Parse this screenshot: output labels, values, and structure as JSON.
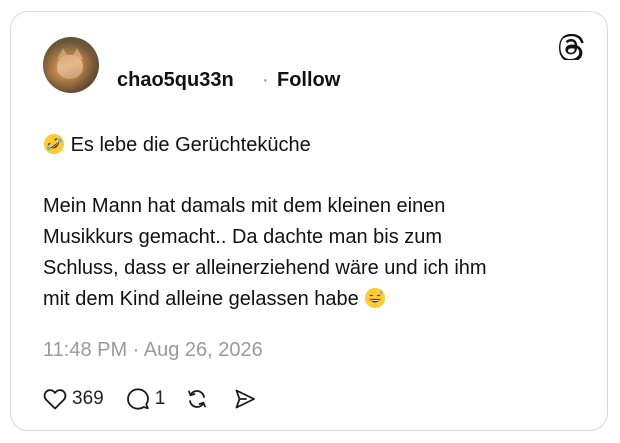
{
  "post": {
    "author": {
      "username": "chao5qu33n",
      "separator": "·",
      "follow_label": "Follow"
    },
    "text": {
      "line1": "Es lebe die Gerüchteküche",
      "line2": "Mein Mann hat damals mit dem kleinen einen",
      "line3": "Musikkurs gemacht.. Da dachte man bis zum",
      "line4": "Schluss, dass er alleinerziehend wäre und ich ihm",
      "line5": "mit dem Kind alleine gelassen habe"
    },
    "emojis": {
      "leading": "rolling-on-floor-laughing-emoji",
      "trailing": "grinning-face-with-sweat-emoji"
    },
    "timestamp": "11:48 PM · Aug 26, 2026",
    "actions": {
      "like_count": "369",
      "reply_count": "1"
    },
    "icons": [
      "threads-logo",
      "heart-icon",
      "reply-icon",
      "repost-icon",
      "share-icon"
    ]
  }
}
